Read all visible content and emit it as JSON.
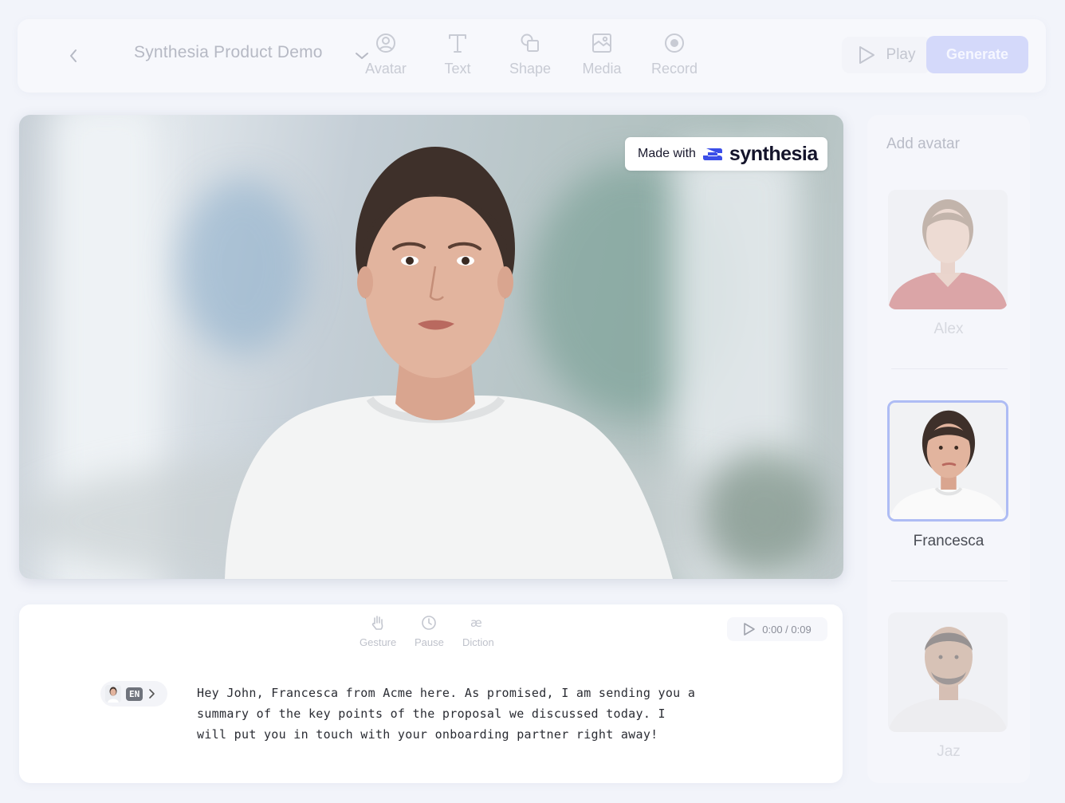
{
  "toolbar": {
    "back_icon": "chevron-left-icon",
    "title": "Synthesia Product Demo",
    "dropdown_icon": "chevron-down-icon",
    "tools": [
      {
        "label": "Avatar",
        "icon": "user-circle-icon"
      },
      {
        "label": "Text",
        "icon": "text-icon"
      },
      {
        "label": "Shape",
        "icon": "shape-icon"
      },
      {
        "label": "Media",
        "icon": "media-icon"
      },
      {
        "label": "Record",
        "icon": "record-icon"
      }
    ],
    "play_label": "Play",
    "generate_label": "Generate"
  },
  "preview": {
    "watermark_prefix": "Made with",
    "watermark_brand": "synthesia",
    "brand_color": "#3b4ee8"
  },
  "editor": {
    "tools": [
      {
        "label": "Gesture",
        "icon": "hand-icon"
      },
      {
        "label": "Pause",
        "icon": "clock-icon"
      },
      {
        "label": "Diction",
        "icon": "ae-ligature-icon"
      }
    ],
    "timer": "0:00 / 0:09",
    "language": "EN",
    "script": "Hey John, Francesca from Acme here. As promised, I am sending you a summary of the key points of the proposal we discussed today. I will put you in touch with your onboarding partner right away!"
  },
  "avatar_panel": {
    "title": "Add avatar",
    "avatars": [
      {
        "name": "Alex",
        "selected": false
      },
      {
        "name": "Francesca",
        "selected": true
      },
      {
        "name": "Jaz",
        "selected": false
      }
    ]
  },
  "colors": {
    "background": "#f2f4fa",
    "generate_button": "#d4d9fa",
    "selected_border": "#aebcf4"
  }
}
